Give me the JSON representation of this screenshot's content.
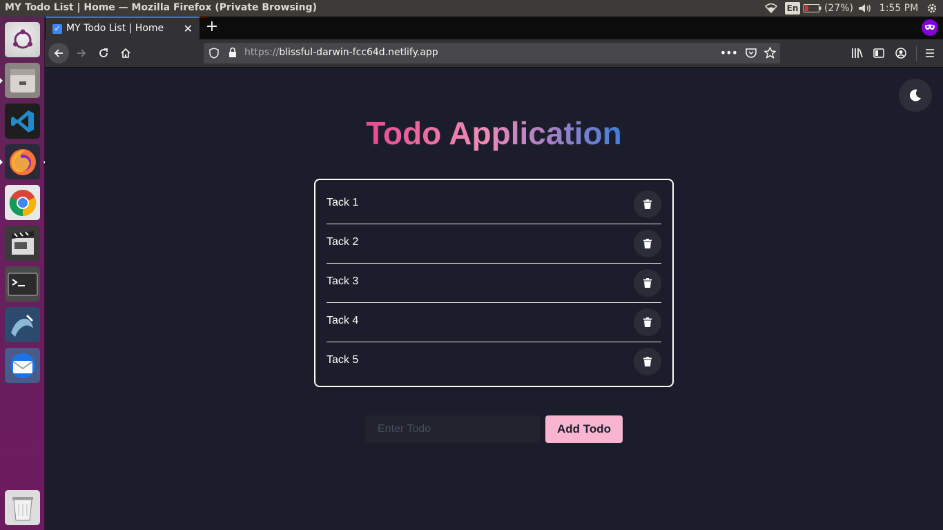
{
  "system": {
    "window_title": "MY Todo List | Home — Mozilla Firefox (Private Browsing)",
    "keyboard_layout": "En",
    "battery": "(27%)",
    "clock": "1:55 PM"
  },
  "launcher": {
    "items": [
      "ubuntu-dash-icon",
      "files-icon",
      "vscode-icon",
      "firefox-icon",
      "chrome-icon",
      "video-editor-icon",
      "terminal-icon",
      "mysql-workbench-icon",
      "thunderbird-icon",
      "trash-icon"
    ]
  },
  "browser": {
    "tab_title": "MY Todo List | Home",
    "url_scheme": "https://",
    "url_host": "blissful-darwin-fcc64d.netlify.app"
  },
  "app": {
    "title": "Todo Application",
    "todos": [
      {
        "text": "Tack 1"
      },
      {
        "text": "Tack 2"
      },
      {
        "text": "Tack 3"
      },
      {
        "text": "Tack 4"
      },
      {
        "text": "Tack 5"
      }
    ],
    "input_placeholder": "Enter Todo",
    "input_value": "",
    "add_button_label": "Add Todo"
  },
  "colors": {
    "page_bg": "#1b1e2a",
    "accent_button": "#f9b4cf",
    "title_gradient": [
      "#e54b8e",
      "#f08bb7",
      "#b07fc4",
      "#3f7fdb"
    ]
  }
}
